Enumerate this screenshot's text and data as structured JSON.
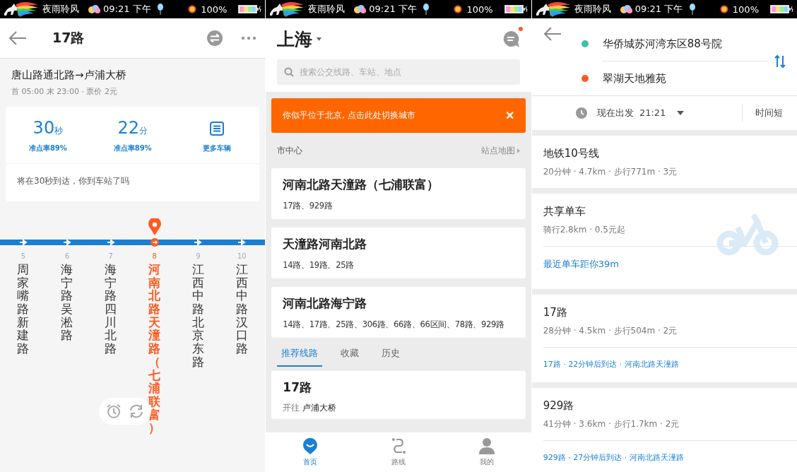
{
  "panels": [
    {
      "status_bar": {
        "app_name": "夜雨聆风",
        "time": "09:21 下午",
        "battery": "100%"
      },
      "header": {
        "title": "17路"
      },
      "route": {
        "direction": "唐山路通北路→卢浦大桥",
        "schedule": "首 05:00 末 23:00 · 票价 2元"
      },
      "arrivals": [
        {
          "kind": "time",
          "value": "30",
          "unit": "秒",
          "label": "准点率89%"
        },
        {
          "kind": "time",
          "value": "22",
          "unit": "分",
          "label": "准点率89%"
        },
        {
          "kind": "more",
          "label": "更多车辆"
        }
      ],
      "notice": "将在30秒到达，你到车站了吗",
      "stops": [
        {
          "number": "5",
          "name": "周家嘴路新建路",
          "selected": false
        },
        {
          "number": "6",
          "name": "海宁路吴淞路",
          "selected": false
        },
        {
          "number": "7",
          "name": "海宁路四川北路",
          "selected": false
        },
        {
          "number": "8",
          "name": "河南北路天潼路（七浦联富）",
          "selected": true
        },
        {
          "number": "9",
          "name": "江西中路北京东路",
          "selected": false
        },
        {
          "number": "10",
          "name": "江西中路汉口路",
          "selected": false
        }
      ]
    },
    {
      "status_bar": {
        "app_name": "夜雨聆风",
        "time": "09:21 下午",
        "battery": "100%"
      },
      "city": "上海",
      "message_unread": true,
      "search": {
        "placeholder": "搜索公交线路、车站、地点"
      },
      "banner": {
        "text": "你似乎位于北京, 点击此处切换城市",
        "close": "✕"
      },
      "section": {
        "title": "市中心",
        "link": "站点地图"
      },
      "stations": [
        {
          "name": "河南北路天潼路（七浦联富）",
          "lines": "17路、929路"
        },
        {
          "name": "天潼路河南北路",
          "lines": "14路、19路、25路"
        },
        {
          "name": "河南北路海宁路",
          "lines": "14路、17路、25路、306路、66路、66区间、78路、929路"
        }
      ],
      "tabs": [
        {
          "label": "推荐线路",
          "selected": true
        },
        {
          "label": "收藏",
          "selected": false
        },
        {
          "label": "历史",
          "selected": false
        }
      ],
      "recommended": {
        "line": "17路",
        "direction_label": "开往",
        "direction": "卢浦大桥"
      },
      "nav": [
        {
          "label": "首页",
          "kind": "home",
          "selected": true
        },
        {
          "label": "路线",
          "kind": "route",
          "selected": false
        },
        {
          "label": "我的",
          "kind": "profile",
          "selected": false
        }
      ]
    },
    {
      "status_bar": {
        "app_name": "夜雨聆风",
        "time": "09:21 下午",
        "battery": "100%"
      },
      "endpoints": [
        {
          "name": "华侨城苏河湾东区88号院",
          "color": "#3cc3a0"
        },
        {
          "name": "翠湖天地雅苑",
          "color": "#ff5a1f"
        }
      ],
      "departure": "现在出发  21:21",
      "sort": "时间短",
      "plans": [
        {
          "kind": "transit",
          "title": "地铁10号线",
          "summary": "20分钟 · 4.7km · 步行771m · 3元"
        },
        {
          "kind": "bike",
          "title": "共享单车",
          "summary": "骑行2.8km · 0.5元起",
          "detail": "最近单车距你39m"
        },
        {
          "kind": "transit",
          "title": "17路",
          "summary": "28分钟 · 4.5km · 步行504m · 2元",
          "detail": "17路 · 22分钟后到达 · 河南北路天潼路"
        },
        {
          "kind": "transit",
          "title": "929路",
          "summary": "41分钟 · 3.6km · 步行1.7km · 2元",
          "detail": "929路 · 27分钟后到达 · 河南北路天潼路"
        }
      ]
    }
  ]
}
